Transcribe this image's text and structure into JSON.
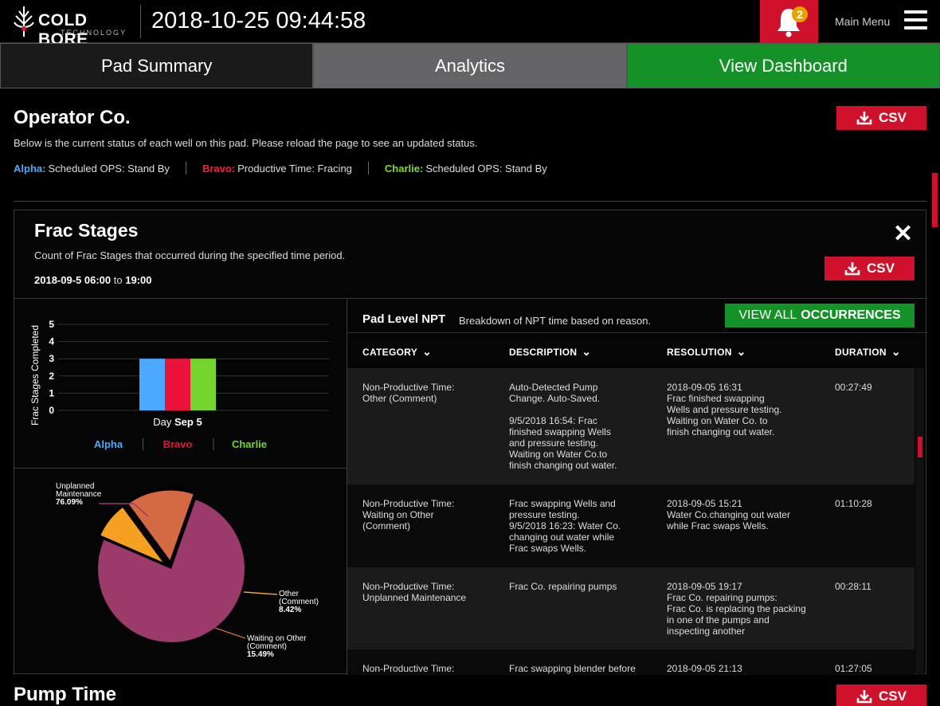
{
  "header": {
    "logo_text": "COLD BORE",
    "logo_sub": "TECHNOLOGY",
    "datetime": "2018-10-25 09:44:58",
    "notification_count": "2",
    "main_menu_label": "Main Menu",
    "brand_color": "#d0112b"
  },
  "tabs": [
    {
      "label": "Pad Summary"
    },
    {
      "label": "Analytics"
    },
    {
      "label": "View Dashboard"
    }
  ],
  "operator": {
    "title": "Operator Co.",
    "description": "Below is the current status of each well on this pad. Please reload the page to see an updated status.",
    "csv_label": "CSV",
    "wells": [
      {
        "name": "Alpha:",
        "status": "Scheduled OPS: Stand By",
        "color": "#4aa8ff"
      },
      {
        "name": "Bravo:",
        "status": "Productive Time: Fracing",
        "color": "#ff1a3c"
      },
      {
        "name": "Charlie:",
        "status": "Scheduled OPS: Stand By",
        "color": "#7ddc2f"
      }
    ]
  },
  "frac": {
    "title": "Frac Stages",
    "description": "Count of Frac Stages that occurred during the specified time period.",
    "range_start": "2018-09-5 06:00",
    "range_to": "to",
    "range_end": "19:00",
    "csv_label": "CSV"
  },
  "chart_data": [
    {
      "type": "bar",
      "ylabel": "Frac Stages Completed",
      "ylim": [
        0,
        5
      ],
      "y_ticks": [
        "0",
        "1",
        "2",
        "3",
        "4",
        "5"
      ],
      "category_prefix": "Day",
      "categories": [
        "Sep 5"
      ],
      "series": [
        {
          "name": "Alpha",
          "values": [
            3
          ],
          "color": "#4aa8ff"
        },
        {
          "name": "Bravo",
          "values": [
            3
          ],
          "color": "#e8123a"
        },
        {
          "name": "Charlie",
          "values": [
            3
          ],
          "color": "#74d62c"
        }
      ],
      "grid": true,
      "legend": "bottom"
    },
    {
      "type": "pie",
      "slices": [
        {
          "label": "Unplanned\nMaintenance",
          "value": 76.09,
          "pct_label": "76.09%",
          "color": "#9c3a6b"
        },
        {
          "label": "Other\n(Comment)",
          "value": 8.42,
          "pct_label": "8.42%",
          "color": "#f5a020"
        },
        {
          "label": "Waiting on Other\n(Comment)",
          "value": 15.49,
          "pct_label": "15.49%",
          "color": "#d46a44"
        }
      ]
    }
  ],
  "npt": {
    "title": "Pad Level NPT",
    "subtitle": "Breakdown of NPT time based on reason.",
    "view_all_prefix": "VIEW ALL",
    "view_all_bold": "OCCURRENCES",
    "columns": [
      "CATEGORY",
      "DESCRIPTION",
      "RESOLUTION",
      "DURATION"
    ],
    "rows": [
      {
        "category": "Non-Productive Time:\nOther (Comment)",
        "description": "Auto-Detected Pump\nChange. Auto-Saved.\n\n9/5/2018 16:54: Frac\nfinished swapping Wells\nand pressure testing.\nWaiting on Water Co.to\nfinish changing out water.",
        "resolution": "2018-09-05 16:31\nFrac finished swapping\nWells and pressure testing.\nWaiting on Water Co. to\nfinish changing out water.",
        "duration": "00:27:49"
      },
      {
        "category": "Non-Productive Time:\nWaiting on Other\n(Comment)",
        "description": "Frac swapping Wells and\npressure testing.\n9/5/2018 16:23: Water Co.\nchanging out water while\nFrac swaps Wells.",
        "resolution": "2018-09-05 15:21\nWater Co.changing out water\nwhile Frac swaps Wells.",
        "duration": "01:10:28"
      },
      {
        "category": "Non-Productive Time:\nUnplanned Maintenance",
        "description": "Frac Co. repairing pumps",
        "resolution": "2018-09-05 19:17\nFrac Co. repairing pumps:\nFrac Co. is replacing the packing\nin one of the pumps and\ninspecting another",
        "duration": "00:28:11"
      },
      {
        "category": "Non-Productive Time:",
        "description": "Frac swapping blender before",
        "resolution": "2018-09-05 21:13",
        "duration": "01:27:05"
      }
    ]
  },
  "pump": {
    "title": "Pump Time",
    "csv_label": "CSV"
  }
}
